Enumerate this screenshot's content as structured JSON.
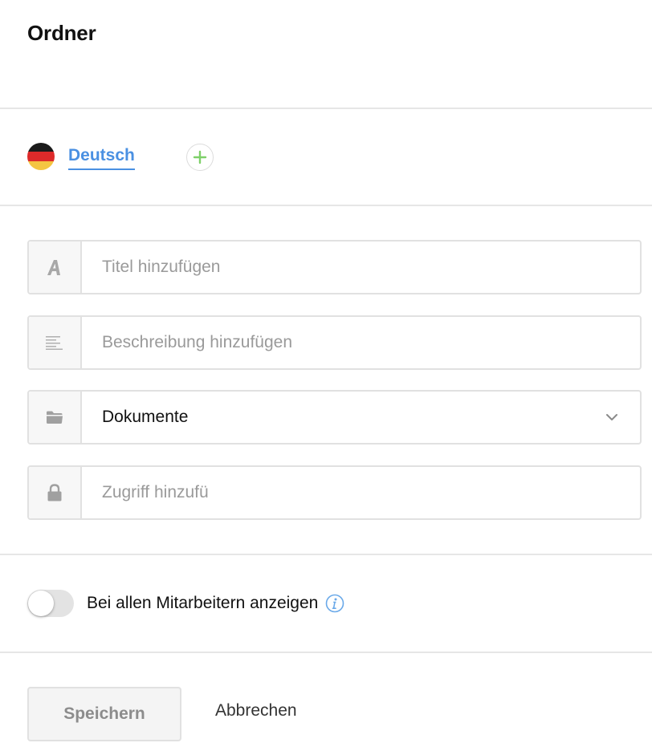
{
  "header": {
    "title": "Ordner"
  },
  "language": {
    "active_label": "Deutsch",
    "flag_colors": [
      "#1b1b1b",
      "#dd2a2a",
      "#f4c542"
    ],
    "add_icon": "plus-circle-icon",
    "add_color": "#7ed069"
  },
  "fields": {
    "title": {
      "icon": "italic-a-icon",
      "placeholder": "Titel hinzufügen",
      "value": ""
    },
    "description": {
      "icon": "align-left-icon",
      "placeholder": "Beschreibung hinzufügen",
      "value": ""
    },
    "folder": {
      "icon": "folder-icon",
      "value": "Dokumente"
    },
    "access": {
      "icon": "lock-icon",
      "placeholder": "Zugriff hinzufü",
      "value": ""
    }
  },
  "visibility": {
    "label": "Bei allen Mitarbeitern anzeigen",
    "enabled": false,
    "info_icon": "info-icon",
    "info_color": "#6aa9e9"
  },
  "actions": {
    "save_label": "Speichern",
    "cancel_label": "Abbrechen"
  }
}
